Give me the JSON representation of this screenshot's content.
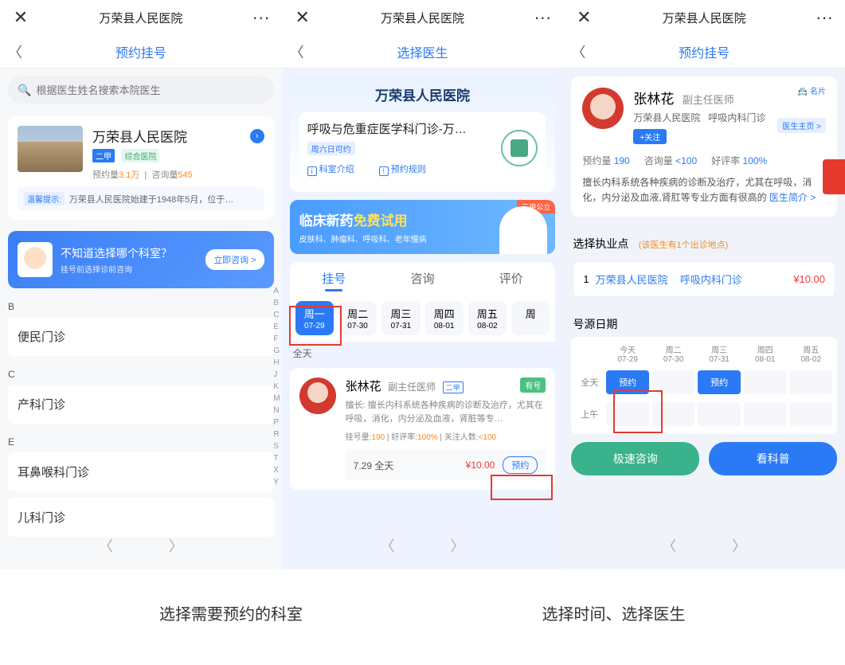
{
  "top": {
    "title": "万荣县人民医院",
    "close": "✕",
    "more": "···"
  },
  "s1": {
    "subtitle": "预约挂号",
    "search_ph": "根据医生姓名搜索本院医生",
    "hospital": "万荣县人民医院",
    "tag1": "二甲",
    "tag2": "综合医院",
    "stat1_lbl": "预约量",
    "stat1_val": "3.1万",
    "stat2_lbl": "咨询量",
    "stat2_val": "545",
    "tip_lbl": "温馨提示:",
    "tip_txt": "万荣县人民医院始建于1948年5月，位于…",
    "banner_q": "不知道选择哪个科室？",
    "banner_s": "挂号前选择诊前咨询",
    "banner_btn": "立即咨询 >",
    "index": [
      "A",
      "B",
      "C",
      "E",
      "F",
      "G",
      "H",
      "J",
      "K",
      "M",
      "N",
      "P",
      "R",
      "S",
      "T",
      "X",
      "Y"
    ],
    "secB": "B",
    "secB_1": "便民门诊",
    "secC": "C",
    "secC_1": "产科门诊",
    "secE": "E",
    "secE_1": "耳鼻喉科门诊",
    "secE_2": "儿科门诊"
  },
  "s2": {
    "subtitle": "选择医生",
    "hname": "万荣县人民医院",
    "dept": "呼吸与危重症医学科门诊-万…",
    "davail": "周六日可约",
    "intro": "科室介绍",
    "rule": "预约规则",
    "b_tag": "三甲公立",
    "b_t1_a": "临床新药",
    "b_t1_b": "免费试用",
    "b_t2": "皮肤科、肿瘤科、呼吸科、老年慢病",
    "tabs": [
      "挂号",
      "咨询",
      "评价"
    ],
    "days": [
      {
        "d": "周一",
        "t": "07-29"
      },
      {
        "d": "周二",
        "t": "07-30"
      },
      {
        "d": "周三",
        "t": "07-31"
      },
      {
        "d": "周四",
        "t": "08-01"
      },
      {
        "d": "周五",
        "t": "08-02"
      },
      {
        "d": "周",
        "t": ""
      }
    ],
    "allday": "全天",
    "doc_name": "张林花",
    "doc_title": "副主任医师",
    "doc_badge": "二甲",
    "has": "有号",
    "doc_desc": "擅长: 擅长内科系统各种疾病的诊断及治疗，尤其在呼吸，消化，内分泌及血液，肾脏等专…",
    "doc_s1": "挂号量:",
    "doc_s1v": "190",
    "doc_s2": "好评率:",
    "doc_s2v": "100%",
    "doc_s3": "关注人数:",
    "doc_s3v": "<100",
    "slot_t": "7.29 全天",
    "slot_p": "¥10.00",
    "slot_btn": "预约"
  },
  "s3": {
    "subtitle": "预约挂号",
    "namecard": "📇 名片",
    "name": "张林花",
    "role": "副主任医师",
    "hosp": "万荣县人民医院",
    "clinic": "呼吸内科门诊",
    "follow": "+关注",
    "docpage": "医生主页 >",
    "st1": "预约量",
    "st1v": "190",
    "st2": "咨询量",
    "st2v": "<100",
    "st3": "好评率",
    "st3v": "100%",
    "desc": "擅长内科系统各种疾病的诊断及治疗，尤其在呼吸，消化，内分泌及血液,肾肛等专业方面有很高的",
    "more": "医生简介 >",
    "loc_h": "选择执业点",
    "loc_note": "(该医生有1个出诊地点)",
    "loc_n": "1",
    "loc_hn": "万荣县人民医院",
    "loc_cn": "呼吸内科门诊",
    "loc_p": "¥10.00",
    "date_h": "号源日期",
    "dhead": [
      {
        "t": "今天",
        "d": "07-29"
      },
      {
        "t": "周二",
        "d": "07-30"
      },
      {
        "t": "周三",
        "d": "07-31"
      },
      {
        "t": "周四",
        "d": "08-01"
      },
      {
        "t": "周五",
        "d": "08-02"
      }
    ],
    "row_all": "全天",
    "row_am": "上午",
    "book": "预约",
    "btn1": "极速咨询",
    "btn2": "看科普"
  },
  "captions": {
    "c1": "选择需要预约的科室",
    "c2": "选择时间、选择医生"
  }
}
